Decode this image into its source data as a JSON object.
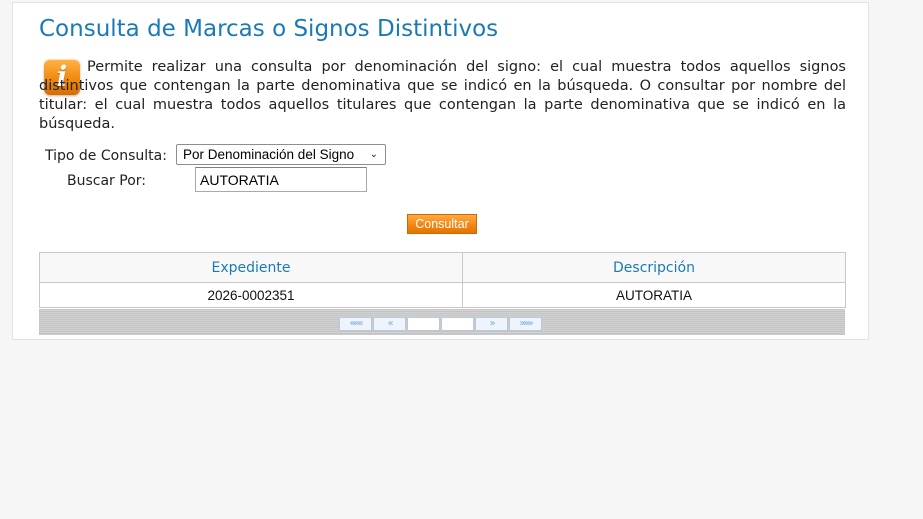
{
  "header": {
    "title": "Consulta de Marcas o Signos Distintivos"
  },
  "info": {
    "icon": "info-icon",
    "icon_glyph": "i",
    "text": "Permite realizar una consulta por denominación del signo: el cual muestra todos aquellos signos distintivos que contengan la parte denominativa que se indicó en la búsqueda. O consultar por nombre del titular: el cual muestra todos aquellos titulares que contengan la parte denominativa que se indicó en la búsqueda."
  },
  "form": {
    "tipo_label": "Tipo de Consulta:",
    "tipo_selected": "Por Denominación del Signo",
    "buscar_label": "Buscar Por:",
    "buscar_value": "AUTORATIA",
    "submit_label": "Consultar"
  },
  "results": {
    "columns": [
      "Expediente",
      "Descripción"
    ],
    "rows": [
      {
        "expediente": "2026-0002351",
        "descripcion": "AUTORATIA"
      }
    ]
  },
  "pager": {
    "first": "«««",
    "prev": "«",
    "next": "»",
    "last": "»»»"
  },
  "colors": {
    "title": "#1a7ab8",
    "accent_orange": "#f28411",
    "pager_arrow": "#7ea8d6"
  }
}
